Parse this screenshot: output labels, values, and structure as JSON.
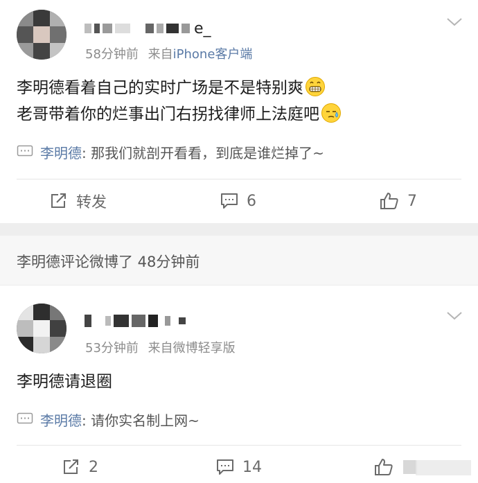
{
  "posts": [
    {
      "username_tail": "e_",
      "time": "58分钟前",
      "source_prefix": "来自",
      "source": "iPhone客户端",
      "content_lines": [
        "李明德看着自己的实时广场是不是特别爽",
        "老哥带着你的烂事出门右拐找律师上法庭吧"
      ],
      "emojis": [
        "grin-emoji",
        "sweat-emoji"
      ],
      "comment_name": "李明德",
      "comment_text": ": 那我们就剖开看看，到底是谁烂掉了~",
      "repost_label": "转发",
      "comment_count": "6",
      "like_count": "7"
    },
    {
      "time": "53分钟前",
      "source_prefix": "来自",
      "source": "微博轻享版",
      "content_lines": [
        "李明德请退圈"
      ],
      "comment_name": "李明德",
      "comment_text": ": 请你实名制上网~",
      "repost_count": "2",
      "comment_count": "14"
    }
  ],
  "activity": "李明德评论微博了 48分钟前",
  "colors": {
    "link": "#5a7aa6",
    "meta": "#8c8c8c",
    "separator": "#eeeeee"
  }
}
